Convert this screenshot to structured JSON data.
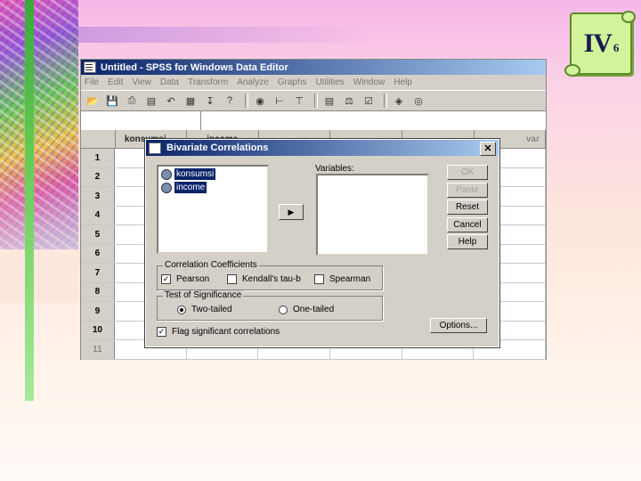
{
  "slide_badge": {
    "roman": "IV",
    "sub": "6"
  },
  "spss": {
    "title": "Untitled - SPSS for Windows Data Editor",
    "menu": [
      "File",
      "Edit",
      "View",
      "Data",
      "Transform",
      "Analyze",
      "Graphs",
      "Utilities",
      "Window",
      "Help"
    ],
    "columns": [
      "konsumsi",
      "income",
      "",
      "",
      "",
      "var"
    ],
    "rows": [
      "1",
      "2",
      "3",
      "4",
      "5",
      "6",
      "7",
      "8",
      "9",
      "10",
      "11"
    ]
  },
  "dialog": {
    "title": "Bivariate Correlations",
    "source_vars": [
      "konsumsi",
      "income"
    ],
    "variables_label": "Variables:",
    "buttons": {
      "ok": "OK",
      "paste": "Paste",
      "reset": "Reset",
      "cancel": "Cancel",
      "help": "Help",
      "options": "Options..."
    },
    "coefficients": {
      "title": "Correlation Coefficients",
      "pearson": "Pearson",
      "kendall": "Kendall's tau-b",
      "spearman": "Spearman"
    },
    "significance": {
      "title": "Test of Significance",
      "two_tailed": "Two-tailed",
      "one_tailed": "One-tailed"
    },
    "flag": "Flag significant correlations"
  }
}
